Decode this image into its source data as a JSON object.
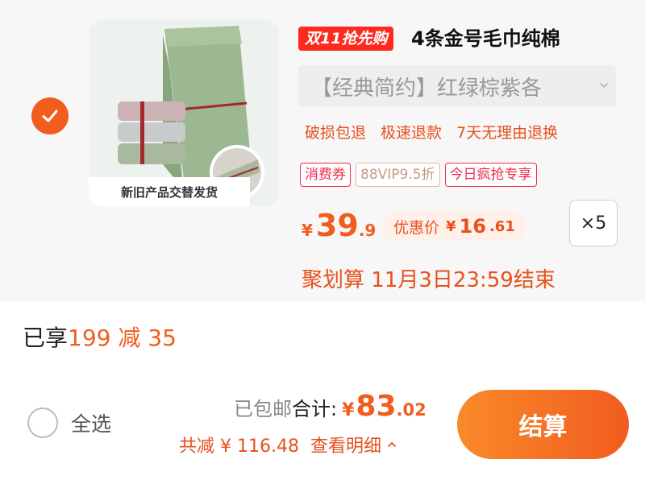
{
  "product": {
    "image_caption": "新旧产品交替发货",
    "promo_badge": "双11抢先购",
    "title": "4条金号毛巾纯棉",
    "sku_text": "【经典简约】红绿棕紫各",
    "services": [
      "破损包退",
      "极速退款",
      "7天无理由退换"
    ],
    "tags": [
      "消费券",
      "88VIP9.5折",
      "今日疯抢专享"
    ],
    "price": {
      "currency": "¥",
      "integer": "39",
      "decimal": ".9"
    },
    "discount": {
      "label": "优惠价",
      "currency": "¥",
      "integer": "16",
      "decimal": ".61"
    },
    "quantity": "×5",
    "event_text": "聚划算 11月3日23:59结束",
    "selected": true
  },
  "summary": {
    "enjoyed_label": "已享",
    "enjoyed_value": "199 减 35",
    "select_all_label": "全选",
    "free_shipping": "已包邮",
    "total_label": "合计:",
    "total": {
      "currency": "¥",
      "integer": "83",
      "decimal": ".02"
    },
    "savings_text": "共减 ¥ 116.48",
    "detail_link": "查看明细",
    "checkout_label": "结算"
  },
  "colors": {
    "accent": "#f25c1f",
    "accent_text": "#e8501c",
    "badge": "#ff2a1f",
    "tag_red": "#ee2b4b"
  },
  "icons": {
    "check": "check-icon",
    "sku_dropdown": "chevron-down-icon",
    "detail_toggle": "caret-up-icon"
  }
}
